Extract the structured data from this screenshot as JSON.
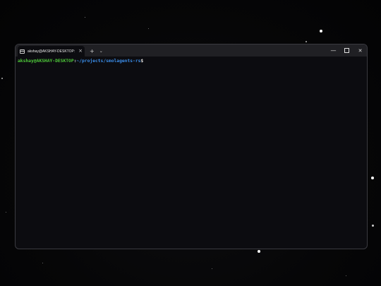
{
  "window": {
    "tab": {
      "icon": "terminal-icon",
      "title": "akshay@AKSHAY-DESKTOP: ~",
      "close_glyph": "×"
    },
    "new_tab_glyph": "+",
    "dropdown_glyph": "⌄",
    "controls": {
      "minimize": "—",
      "close": "✕"
    }
  },
  "terminal": {
    "prompt": {
      "user_host": "akshay@AKSHAY-DESKTOP",
      "separator": ":",
      "path": "~/projects/smolagents-rs",
      "symbol": "$"
    }
  },
  "colors": {
    "user_host": "#4ec93a",
    "path": "#3b8eea",
    "terminal_bg": "#0c0c10",
    "titlebar_bg": "#202024"
  }
}
